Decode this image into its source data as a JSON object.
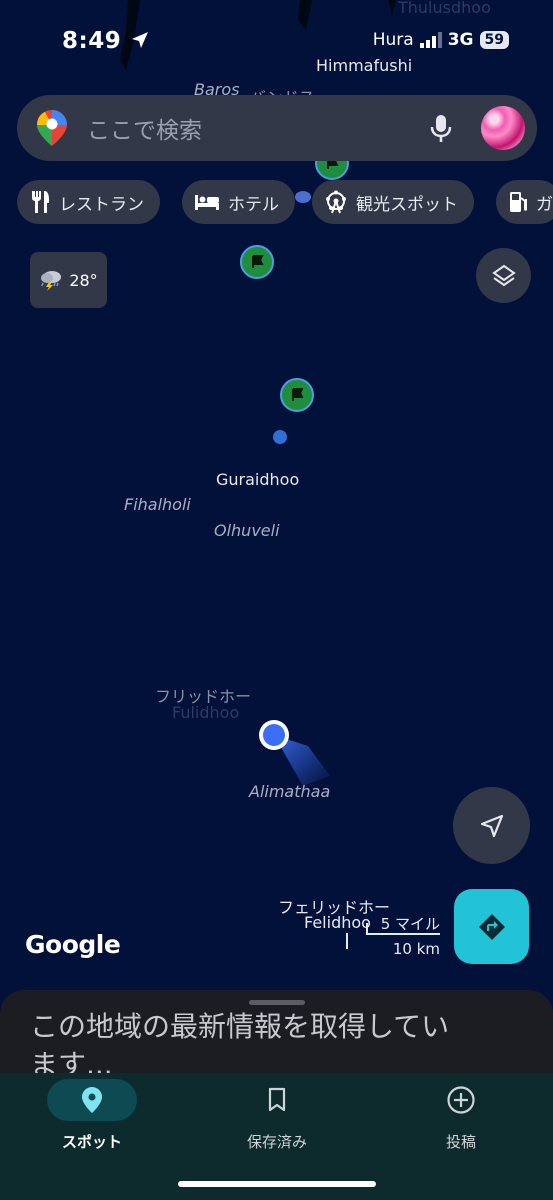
{
  "status_bar": {
    "time": "8:49",
    "carrier": "Hura",
    "network": "3G",
    "battery": "59"
  },
  "search": {
    "placeholder": "ここで検索"
  },
  "chips": [
    {
      "label": "レストラン",
      "icon": "fork-knife-icon"
    },
    {
      "label": "ホテル",
      "icon": "bed-icon"
    },
    {
      "label": "観光スポット",
      "icon": "ferris-wheel-icon"
    },
    {
      "label": "ガ",
      "icon": "gas-station-icon"
    }
  ],
  "weather": {
    "temperature": "28°",
    "icon": "thunderstorm-icon"
  },
  "map_labels": {
    "thulusdhoo": "Thulusdhoo",
    "himmafushi": "Himmafushi",
    "baros": "Baros",
    "baros_jp": "バンドス",
    "guraidhoo": "Guraidhoo",
    "fihalholi": "Fihalholi",
    "olhuveli": "Olhuveli",
    "fulidhoo_jp": "フリッドホー",
    "fulidhoo": "Fulidhoo",
    "alimathaa": "Alimathaa",
    "felidhoo_jp": "フェリッドホー",
    "felidhoo": "Felidhoo"
  },
  "scale": {
    "miles": "5 マイル",
    "km": "10 km"
  },
  "google_logo": "Google",
  "bottom_sheet": {
    "message": "この地域の最新情報を取得しています..."
  },
  "nav": {
    "items": [
      {
        "label": "スポット",
        "icon": "location-pin-icon",
        "active": true
      },
      {
        "label": "保存済み",
        "icon": "bookmark-icon",
        "active": false
      },
      {
        "label": "投稿",
        "icon": "add-circle-icon",
        "active": false
      }
    ]
  },
  "colors": {
    "map_background": "#02113a",
    "accent_teal": "#22c3d6",
    "location_blue": "#3b6ef5",
    "poi_green": "#1e8e3e"
  }
}
